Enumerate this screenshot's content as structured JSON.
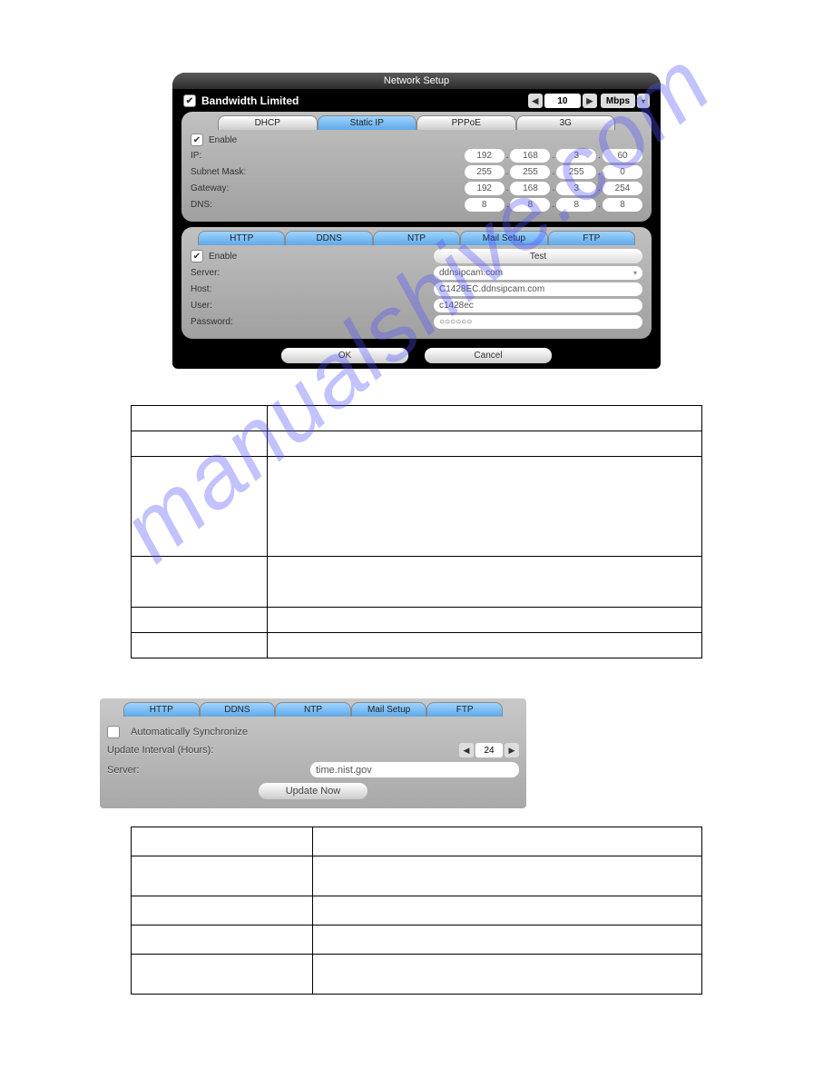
{
  "watermark": "manualshive.com",
  "panel": {
    "title": "Network Setup",
    "bandwidth": {
      "label": "Bandwidth Limited",
      "checked": true,
      "value": "10",
      "unit": "Mbps"
    },
    "topTabs": [
      "DHCP",
      "Static IP",
      "PPPoE",
      "3G"
    ],
    "topSelected": 1,
    "enable": {
      "label": "Enable",
      "checked": true
    },
    "fields": {
      "ip": {
        "label": "IP:",
        "seg": [
          "192",
          "168",
          "3",
          "60"
        ]
      },
      "mask": {
        "label": "Subnet Mask:",
        "seg": [
          "255",
          "255",
          "255",
          "0"
        ]
      },
      "gateway": {
        "label": "Gateway:",
        "seg": [
          "192",
          "168",
          "3",
          "254"
        ]
      },
      "dns": {
        "label": "DNS:",
        "seg": [
          "8",
          "8",
          "8",
          "8"
        ]
      }
    },
    "botTabs": [
      "HTTP",
      "DDNS",
      "NTP",
      "Mail Setup",
      "FTP"
    ],
    "botSelected": 1,
    "ddns": {
      "enable": {
        "label": "Enable",
        "checked": true
      },
      "test": "Test",
      "server": {
        "label": "Server:",
        "value": "ddnsipcam.com"
      },
      "host": {
        "label": "Host:",
        "value": "C1428EC.ddnsipcam.com"
      },
      "user": {
        "label": "User:",
        "value": "c1428ec"
      },
      "password": {
        "label": "Password:",
        "value": "○○○○○○"
      }
    },
    "ok": "OK",
    "cancel": "Cancel"
  },
  "ntp": {
    "tabs": [
      "HTTP",
      "DDNS",
      "NTP",
      "Mail Setup",
      "FTP"
    ],
    "selected": 2,
    "auto": {
      "label": "Automatically Synchronize",
      "checked": false
    },
    "interval": {
      "label": "Update Interval (Hours):",
      "value": "24"
    },
    "server": {
      "label": "Server:",
      "value": "time.nist.gov"
    },
    "update": "Update Now"
  }
}
